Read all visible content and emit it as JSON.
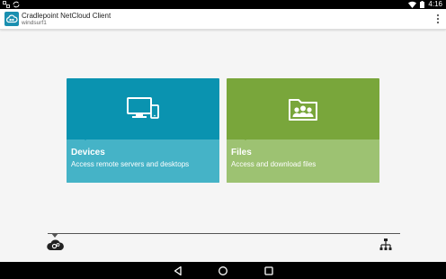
{
  "status_bar": {
    "time": "4:16",
    "icons": [
      "network-icon",
      "sync-icon",
      "wifi-icon",
      "battery-icon"
    ]
  },
  "app_bar": {
    "title": "Cradlepoint NetCloud Client",
    "subtitle": "windsurf1",
    "logo_icon": "cloud-link-icon",
    "menu_icon": "more-vert-icon"
  },
  "cards": {
    "devices": {
      "title": "Devices",
      "description": "Access remote servers and desktops",
      "icon": "monitor-phone-icon",
      "color_top": "#0a93b0",
      "color_bottom": "#45b3c7"
    },
    "files": {
      "title": "Files",
      "description": "Access and download files",
      "icon": "shared-folder-icon",
      "color_top": "#79a63b",
      "color_bottom": "#9dc272"
    }
  },
  "toolbar": {
    "left_icon": "cloud-gear-icon",
    "right_icon": "network-tree-icon"
  },
  "nav_bar": {
    "buttons": [
      "back-icon",
      "home-icon",
      "recents-icon"
    ]
  }
}
